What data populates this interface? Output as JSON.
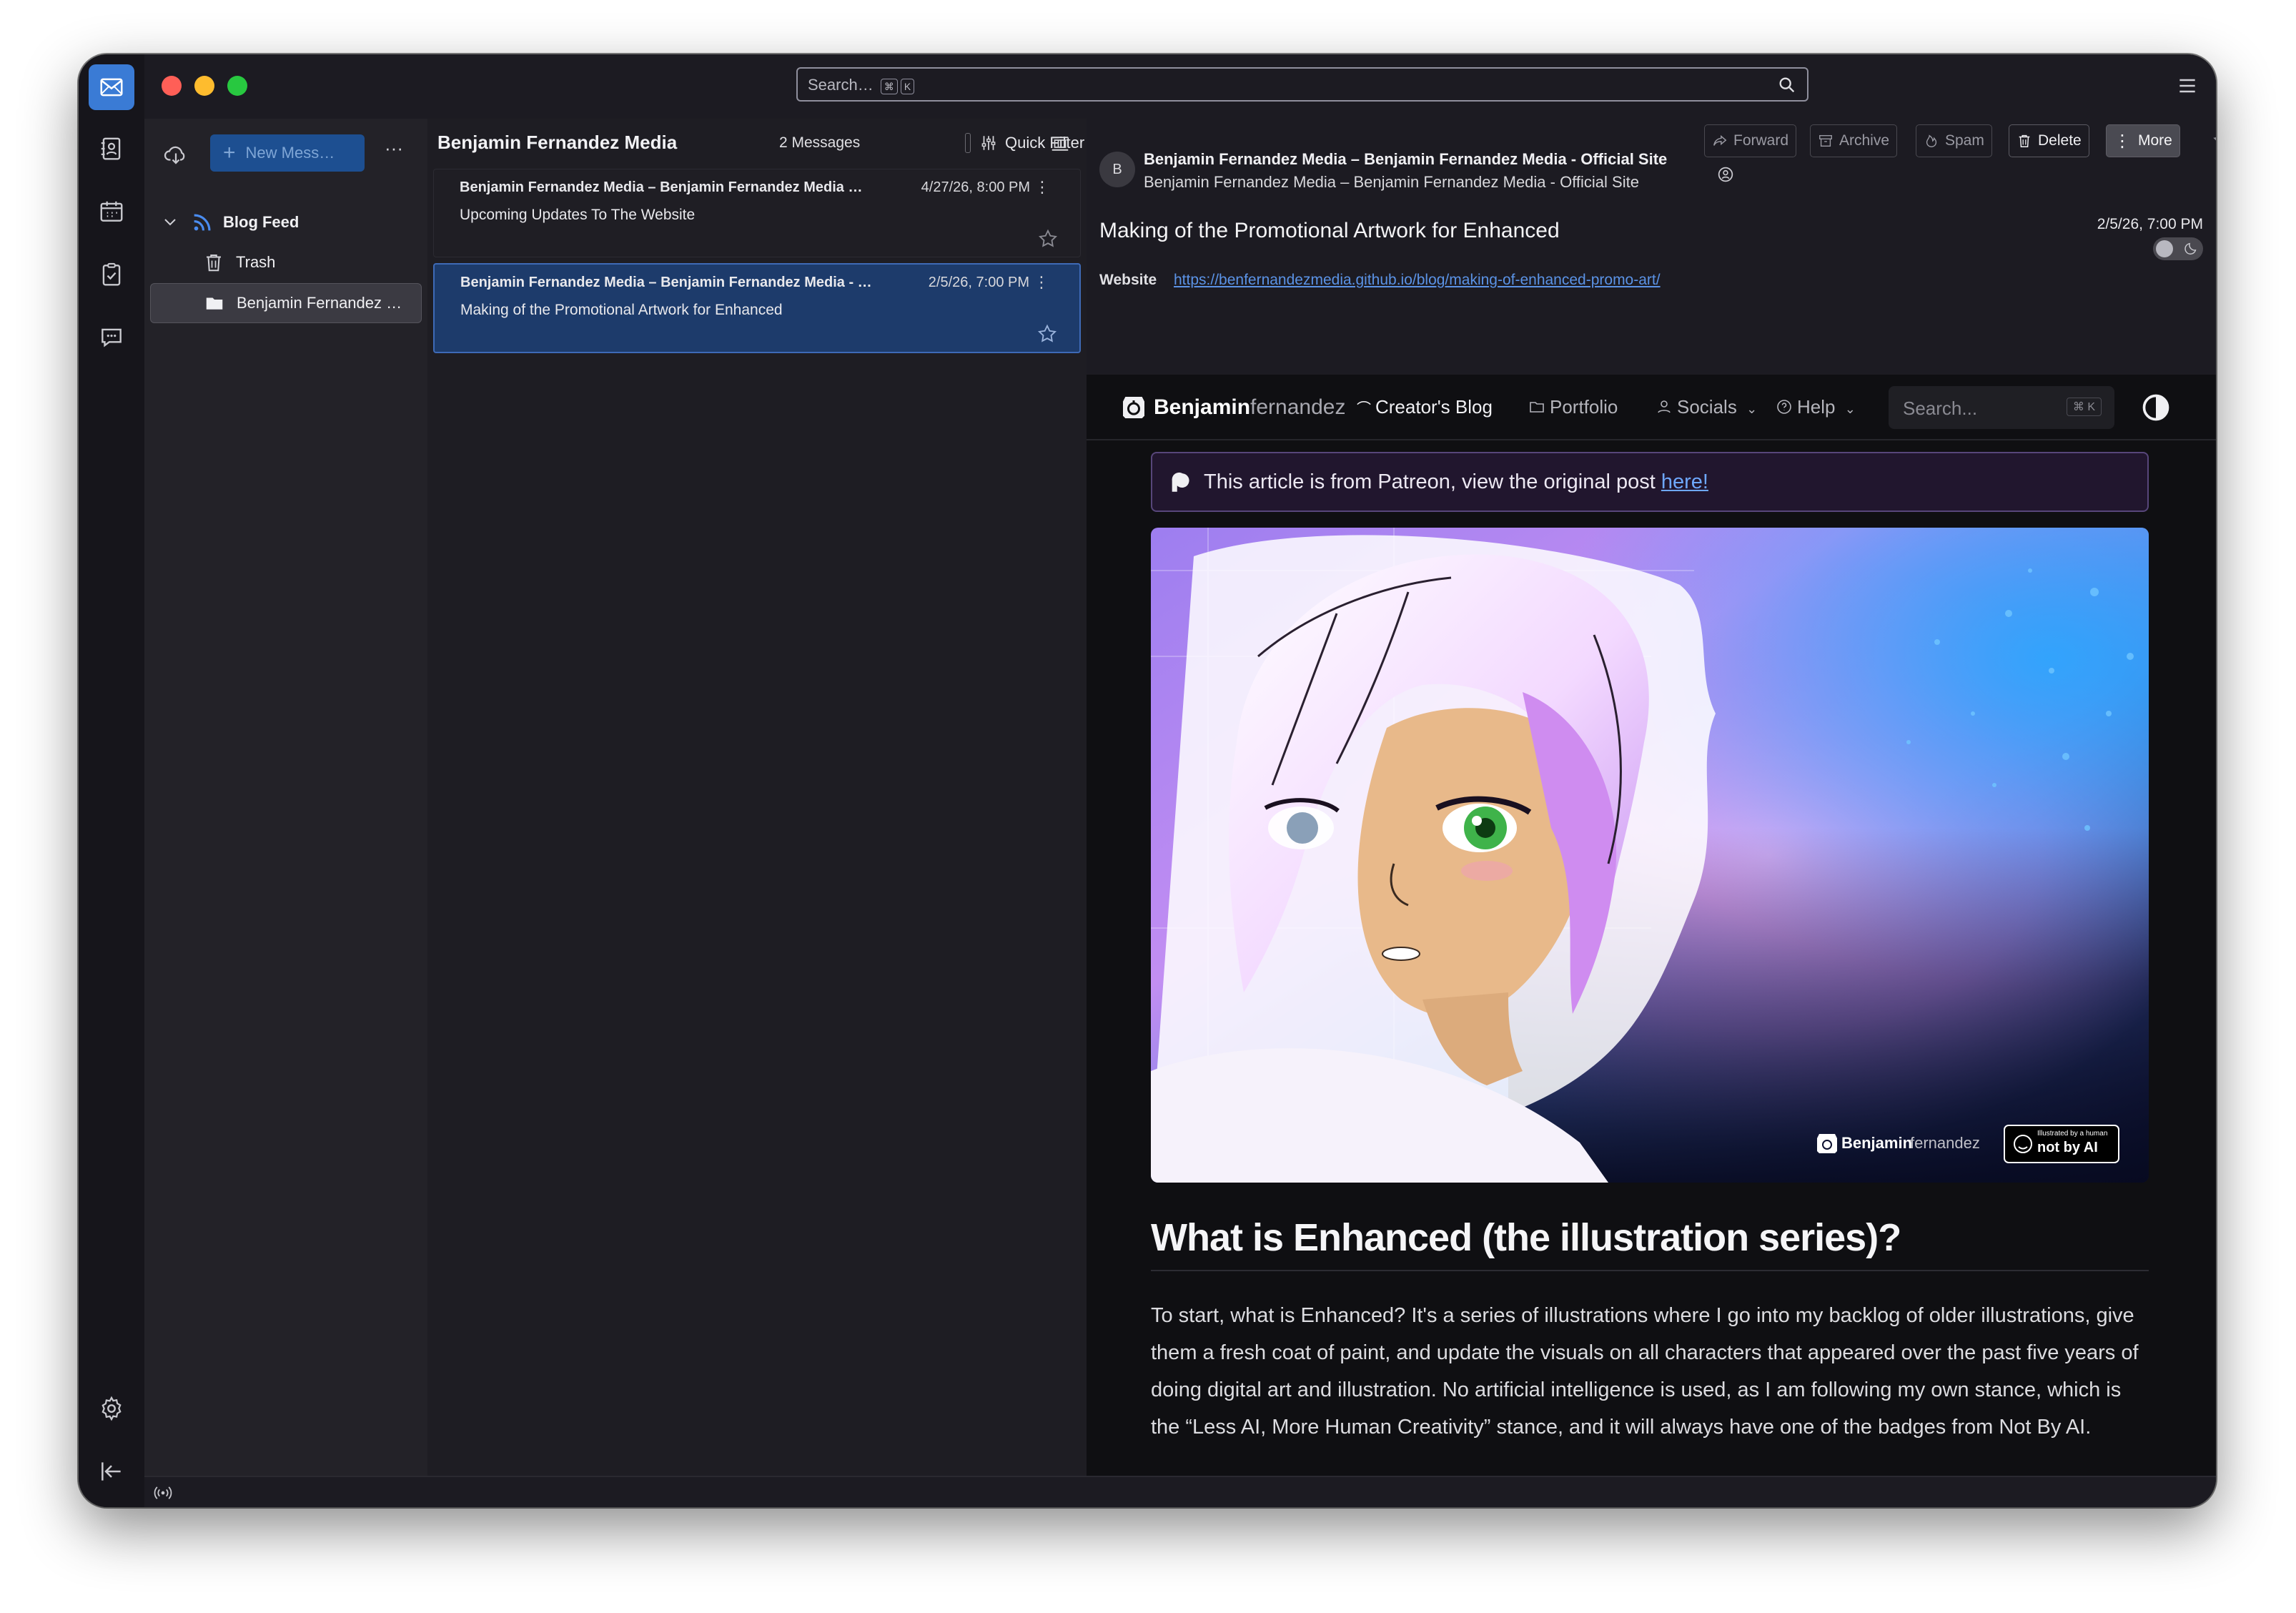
{
  "titlebar": {
    "search_placeholder": "Search…",
    "search_shortcut_1": "⌘",
    "search_shortcut_2": "K"
  },
  "folders": {
    "new_message": "New Mess…",
    "more": "···",
    "items": [
      {
        "label": "Blog Feed"
      },
      {
        "label": "Trash"
      },
      {
        "label": "Benjamin Fernandez …"
      }
    ]
  },
  "list": {
    "title": "Benjamin Fernandez Media",
    "count": "2 Messages",
    "quick_filter": "Quick Filter",
    "messages": [
      {
        "from": "Benjamin Fernandez Media – Benjamin Fernandez Media …",
        "date": "4/27/26, 8:00 PM",
        "subject": "Upcoming Updates To The Website"
      },
      {
        "from": "Benjamin Fernandez Media – Benjamin Fernandez Media - …",
        "date": "2/5/26, 7:00 PM",
        "subject": "Making of the Promotional Artwork for Enhanced"
      }
    ]
  },
  "reader": {
    "buttons": {
      "forward": "Forward",
      "archive": "Archive",
      "spam": "Spam",
      "delete": "Delete",
      "more": "More"
    },
    "avatar": "B",
    "from": "Benjamin Fernandez Media – Benjamin Fernandez Media - Official Site",
    "to": "Benjamin Fernandez Media – Benjamin Fernandez Media - Official Site",
    "subject": "Making of the Promotional Artwork for Enhanced",
    "date": "2/5/26, 7:00 PM",
    "website_label": "Website",
    "website_url": "https://benfernandezmedia.github.io/blog/making-of-enhanced-promo-art/"
  },
  "web": {
    "logo_bold": "Benjamin",
    "logo_light": "fernandez",
    "nav": {
      "blog": "Creator's Blog",
      "portfolio": "Portfolio",
      "socials": "Socials",
      "help": "Help"
    },
    "search_placeholder": "Search...",
    "search_kbd": "⌘ K",
    "banner_text": "This article is from Patreon, view the original post ",
    "banner_link": "here!",
    "hero_logo_bold": "Benjamin",
    "hero_logo_light": "fernandez",
    "badge_small": "Illustrated by a human",
    "badge_big": "not by AI",
    "heading": "What is Enhanced (the illustration series)?",
    "paragraph": "To start, what is Enhanced? It's a series of illustrations where I go into my backlog of older illustrations, give them a fresh coat of paint, and update the visuals on all characters that appeared over the past five years of doing digital art and illustration. No artificial intelligence is used, as I am following my own stance, which is the “Less AI, More Human Creativity” stance, and it will always have one of the badges from Not By AI."
  },
  "colors": {
    "accent": "#3a7bd5",
    "selected_row": "#1d3b6b",
    "link": "#6ea8ff",
    "banner_bg": "#21162e"
  }
}
